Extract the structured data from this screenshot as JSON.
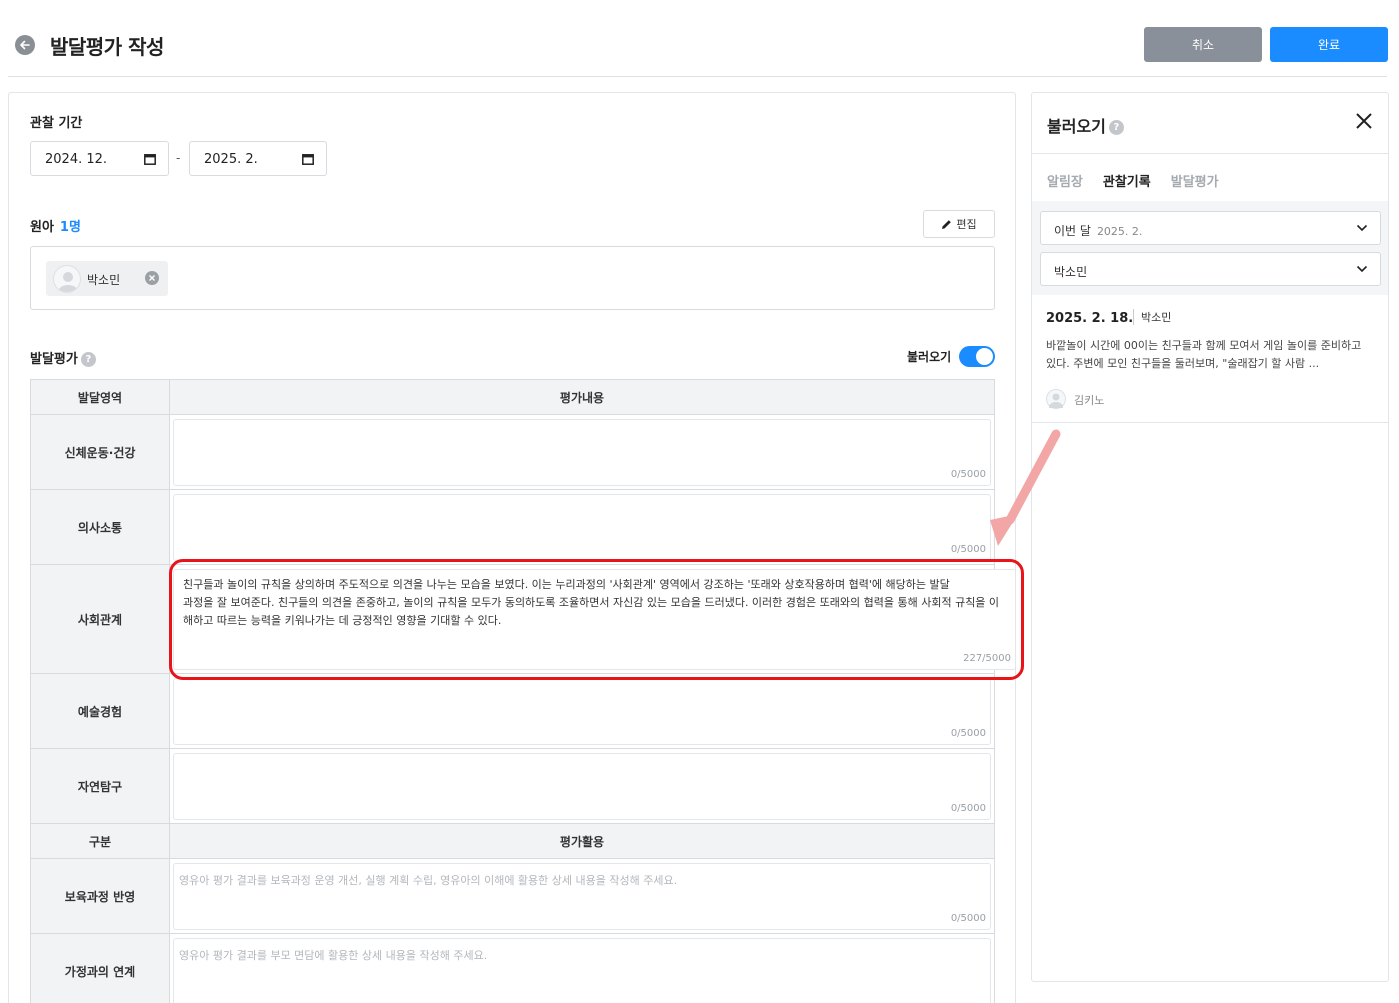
{
  "header": {
    "title": "발달평가 작성",
    "cancel_label": "취소",
    "done_label": "완료"
  },
  "period": {
    "label": "관찰 기간",
    "start": "2024. 12.",
    "separator": "-",
    "end": "2025. 2."
  },
  "children": {
    "label": "원아",
    "count": "1명",
    "edit_label": "편집",
    "items": [
      "박소민"
    ]
  },
  "evaluation": {
    "label": "발달평가",
    "import_toggle_label": "불러오기",
    "import_toggle_on": true,
    "header_area": "발달영역",
    "header_content": "평가내용",
    "rows": [
      {
        "area": "신체운동·건강",
        "text": "",
        "counter": "0/5000"
      },
      {
        "area": "의사소통",
        "text": "",
        "counter": "0/5000"
      },
      {
        "area": "사회관계",
        "text": "친구들과 놀이의 규칙을 상의하며 주도적으로 의견을 나누는 모습을 보였다. 이는 누리과정의 '사회관계' 영역에서 강조하는 '또래와 상호작용하며 협력'에 해당하는 발달\n과정을 잘 보여준다. 친구들의 의견을 존중하고, 놀이의 규칙을 모두가 동의하도록 조율하면서 자신감 있는 모습을 드러냈다. 이러한 경험은 또래와의 협력을 통해 사회적 규칙을 이해하고 따르는 능력을 키워나가는 데 긍정적인 영향을 기대할 수 있다.",
        "counter": "227/5000"
      },
      {
        "area": "예술경험",
        "text": "",
        "counter": "0/5000"
      },
      {
        "area": "자연탐구",
        "text": "",
        "counter": "0/5000"
      }
    ],
    "header_category": "구분",
    "header_usage": "평가활용",
    "usage_rows": [
      {
        "area": "보육과정 반영",
        "placeholder": "영유아 평가 결과를 보육과정 운영 개선, 실행 계획 수립, 영유아의 이해에 활용한 상세 내용을 작성해 주세요.",
        "counter": "0/5000"
      },
      {
        "area": "가정과의 연계",
        "placeholder": "영유아 평가 결과를 부모 면담에 활용한 상세 내용을 작성해 주세요.",
        "counter": ""
      }
    ]
  },
  "import_panel": {
    "title": "불러오기",
    "tabs": [
      "알림장",
      "관찰기록",
      "발달평가"
    ],
    "active_tab": "관찰기록",
    "month_select_label": "이번 달",
    "month_select_value": "2025. 2.",
    "child_select_value": "박소민",
    "record": {
      "date": "2025. 2. 18.",
      "child": "박소민",
      "text": "바깥놀이 시간에 00이는 친구들과 함께 모여서 게임 놀이를 준비하고 있다. 주변에 모인 친구들을 둘러보며, \"술래잡기 할 사람 ...",
      "author": "김키노"
    }
  },
  "colors": {
    "primary": "#1a8cff",
    "cancel": "#8a9099",
    "highlight": "#e8141a",
    "arrow": "#f2a6a6"
  }
}
